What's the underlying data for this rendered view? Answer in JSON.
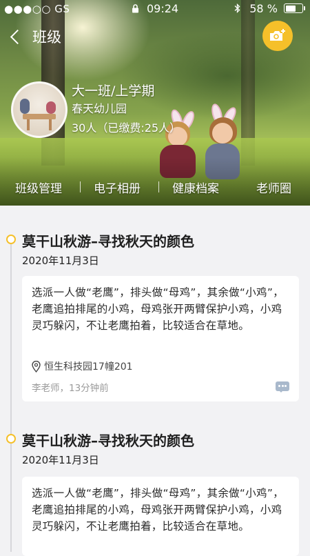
{
  "status_bar": {
    "signal": "●●●○○ GS",
    "time": "09:24",
    "battery": "58 %"
  },
  "header": {
    "back_label": "班级",
    "class_name": "大一班/上学期",
    "school": "春天幼儿园",
    "count": "30人（已缴费:25人）",
    "accent_color": "#f5c02a"
  },
  "tabs": [
    {
      "label": "班级管理"
    },
    {
      "label": "电子相册"
    },
    {
      "label": "健康档案"
    },
    {
      "label": "老师圈"
    }
  ],
  "posts": [
    {
      "title": "莫干山秋游–寻找秋天的颜色",
      "date": "2020年11月3日",
      "content": "选派一人做“老鹰”，排头做“母鸡”，其余做“小鸡”，老鹰追拍排尾的小鸡，母鸡张开两臂保护小鸡，小鸡灵巧躲闪，不让老鹰拍着，比较适合在草地。",
      "location": "恒生科技园17幢201",
      "meta": "李老师，13分钟前"
    },
    {
      "title": "莫干山秋游–寻找秋天的颜色",
      "date": "2020年11月3日",
      "content": "选派一人做“老鹰”，排头做“母鸡”，其余做“小鸡”，老鹰追拍排尾的小鸡，母鸡张开两臂保护小鸡，小鸡灵巧躲闪，不让老鹰拍着，比较适合在草地。"
    }
  ]
}
